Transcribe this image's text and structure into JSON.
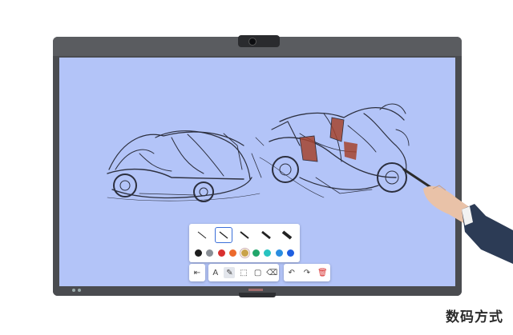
{
  "scene": {
    "device": "interactive-display",
    "screen_background": "#b3c4f8"
  },
  "pen_panel": {
    "pens": [
      {
        "icon": "thin-pen-icon",
        "selected": false
      },
      {
        "icon": "highlighter-pen-icon",
        "selected": true
      },
      {
        "icon": "medium-pen-icon",
        "selected": false
      },
      {
        "icon": "thick-pen-icon",
        "selected": false
      },
      {
        "icon": "marker-pen-icon",
        "selected": false
      }
    ],
    "colors": [
      "#1d1d1d",
      "#8a8f96",
      "#d8302f",
      "#ec6a2c",
      "#c9a24a",
      "#21a66b",
      "#28c3c0",
      "#2a8de0",
      "#1f5fe0"
    ],
    "selected_color_index": 4
  },
  "toolbar": {
    "groups": [
      {
        "tools": [
          {
            "icon": "collapse-icon",
            "glyph": "⇤"
          }
        ]
      },
      {
        "tools": [
          {
            "icon": "text-tool-icon",
            "glyph": "A"
          },
          {
            "icon": "pen-tool-icon",
            "glyph": "✎"
          },
          {
            "icon": "select-tool-icon",
            "glyph": "⬚"
          },
          {
            "icon": "shape-tool-icon",
            "glyph": "▢"
          },
          {
            "icon": "eraser-icon",
            "glyph": "⌫"
          }
        ]
      },
      {
        "tools": [
          {
            "icon": "undo-icon",
            "glyph": "↶"
          },
          {
            "icon": "redo-icon",
            "glyph": "↷"
          },
          {
            "icon": "delete-icon",
            "glyph": "🗑"
          }
        ]
      }
    ]
  },
  "watermark": {
    "text": "数码方式"
  }
}
